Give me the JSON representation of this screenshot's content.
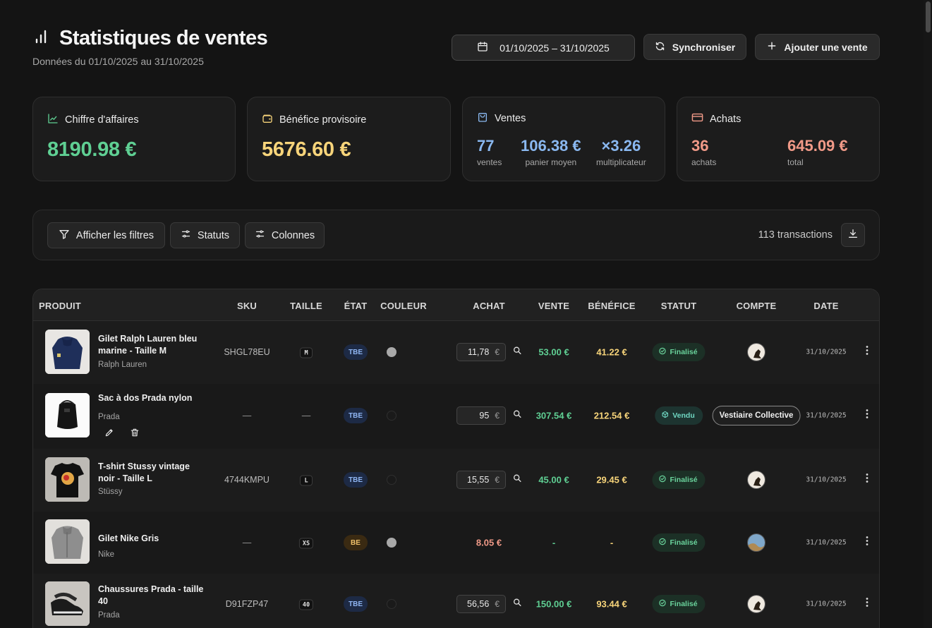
{
  "header": {
    "title": "Statistiques de ventes",
    "subtitle": "Données du 01/10/2025 au 31/10/2025",
    "date_range": "01/10/2025 – 31/10/2025",
    "sync_label": "Synchroniser",
    "add_label": "Ajouter une vente"
  },
  "stats": {
    "revenue": {
      "title": "Chiffre d'affaires",
      "value": "8190.98 €"
    },
    "profit": {
      "title": "Bénéfice provisoire",
      "value": "5676.60 €"
    },
    "sales": {
      "title": "Ventes",
      "count": "77",
      "count_label": "ventes",
      "avg": "106.38 €",
      "avg_label": "panier moyen",
      "mult": "×3.26",
      "mult_label": "multiplicateur"
    },
    "purchases": {
      "title": "Achats",
      "count": "36",
      "count_label": "achats",
      "total": "645.09 €",
      "total_label": "total"
    }
  },
  "filters": {
    "show_filters": "Afficher les filtres",
    "statuses": "Statuts",
    "columns": "Colonnes",
    "transactions": "113 transactions"
  },
  "table": {
    "columns": [
      "PRODUIT",
      "SKU",
      "TAILLE",
      "ÉTAT",
      "COULEUR",
      "ACHAT",
      "VENTE",
      "BÉNÉFICE",
      "STATUT",
      "COMPTE",
      "DATE"
    ],
    "rows": [
      {
        "name": "Gilet Ralph Lauren bleu marine - Taille M",
        "brand": "Ralph Lauren",
        "sku": "SHGL78EU",
        "size": "M",
        "etat": "TBE",
        "color": "grey",
        "achat": "11,78",
        "achat_unit": "€",
        "vente": "53.00 €",
        "benefice": "41.22 €",
        "status": "Finalisé",
        "account": "avatar",
        "date": "31/10/2025"
      },
      {
        "name": "Sac à dos Prada nylon",
        "brand": "Prada",
        "sku": "—",
        "size": "—",
        "etat": "TBE",
        "color": "none",
        "achat": "95",
        "achat_unit": "€",
        "vente": "307.54 €",
        "benefice": "212.54 €",
        "status": "Vendu",
        "account": "Vestiaire Collective",
        "date": "31/10/2025"
      },
      {
        "name": "T-shirt Stussy vintage noir - Taille L",
        "brand": "Stüssy",
        "sku": "4744KMPU",
        "size": "L",
        "etat": "TBE",
        "color": "none",
        "achat": "15,55",
        "achat_unit": "€",
        "vente": "45.00 €",
        "benefice": "29.45 €",
        "status": "Finalisé",
        "account": "avatar",
        "date": "31/10/2025"
      },
      {
        "name": "Gilet Nike Gris",
        "brand": "Nike",
        "sku": "—",
        "size": "XS",
        "etat": "BE",
        "color": "grey",
        "achat": "8.05 €",
        "vente": "-",
        "benefice": "-",
        "status": "Finalisé",
        "account": "avatar",
        "date": "31/10/2025"
      },
      {
        "name": "Chaussures Prada - taille 40",
        "brand": "Prada",
        "sku": "D91FZP47",
        "size": "40",
        "etat": "TBE",
        "color": "none",
        "achat": "56,56",
        "achat_unit": "€",
        "vente": "150.00 €",
        "benefice": "93.44 €",
        "status": "Finalisé",
        "account": "avatar",
        "date": "31/10/2025"
      }
    ]
  },
  "colors": {
    "revenue": "#5fcf93",
    "profit": "#f7d47a",
    "sales": "#8ab8f0",
    "purchases": "#f19a88"
  }
}
